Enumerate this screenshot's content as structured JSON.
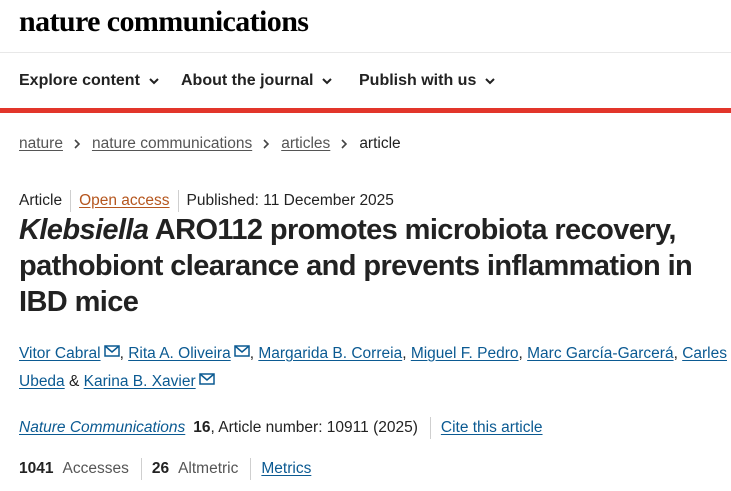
{
  "site": {
    "logo": "nature communications"
  },
  "nav": {
    "items": [
      {
        "label": "Explore content"
      },
      {
        "label": "About the journal"
      },
      {
        "label": "Publish with us"
      }
    ]
  },
  "breadcrumb": {
    "items": [
      "nature",
      "nature communications",
      "articles"
    ],
    "current": "article"
  },
  "article_meta": {
    "type": "Article",
    "access": "Open access",
    "published": "Published: 11 December 2025"
  },
  "article": {
    "title_italic": "Klebsiella",
    "title_rest": " ARO112 promotes microbiota recovery, pathobiont clearance and prevents inflammation in IBD mice"
  },
  "authors": [
    {
      "name": "Vitor Cabral",
      "email": true
    },
    {
      "name": "Rita A. Oliveira",
      "email": true
    },
    {
      "name": "Margarida B. Correia",
      "email": false
    },
    {
      "name": "Miguel F. Pedro",
      "email": false
    },
    {
      "name": "Marc García-Garcerá",
      "email": false
    },
    {
      "name": "Carles Ubeda",
      "email": false
    },
    {
      "name": "Karina B. Xavier",
      "email": true
    }
  ],
  "author_separators": {
    "comma": ",",
    "and": "&"
  },
  "citation": {
    "journal": "Nature Communications",
    "volume": "16",
    "article_number": ", Article number: 10911 (2025)",
    "cite_label": "Cite this article"
  },
  "metrics": {
    "accesses_count": "1041",
    "accesses_label": "Accesses",
    "altmetric_count": "26",
    "altmetric_label": "Altmetric",
    "metrics_link": "Metrics"
  },
  "colors": {
    "accent_red": "#e2352a",
    "link_blue": "#0b5a92",
    "open_access_orange": "#b5561e"
  },
  "icons": [
    "chevron-down-icon",
    "chevron-right-icon",
    "envelope-icon"
  ]
}
